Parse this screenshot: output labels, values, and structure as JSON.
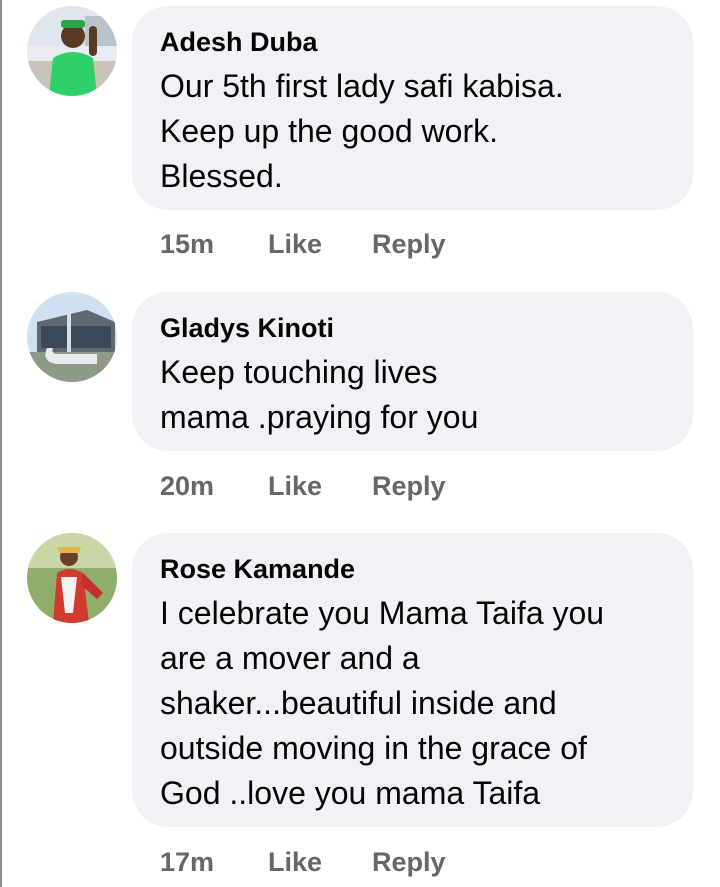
{
  "comments": [
    {
      "author": "Adesh Duba",
      "text": "Our 5th  first lady safi kabisa.\nKeep up the good work.\nBlessed.",
      "time": "15m",
      "like_label": "Like",
      "reply_label": "Reply"
    },
    {
      "author": "Gladys Kinoti",
      "text": "Keep touching lives\nmama .praying for you",
      "time": "20m",
      "like_label": "Like",
      "reply_label": "Reply"
    },
    {
      "author": "Rose Kamande",
      "text": "I celebrate you Mama Taifa you\nare a mover and a\nshaker...beautiful inside and\noutside moving in the grace of\nGod ..love you mama Taifa",
      "time": "17m",
      "like_label": "Like",
      "reply_label": "Reply"
    }
  ],
  "colors": {
    "bubble": "#f0f2f5",
    "meta_text": "#65676b",
    "body_text": "#050505"
  }
}
